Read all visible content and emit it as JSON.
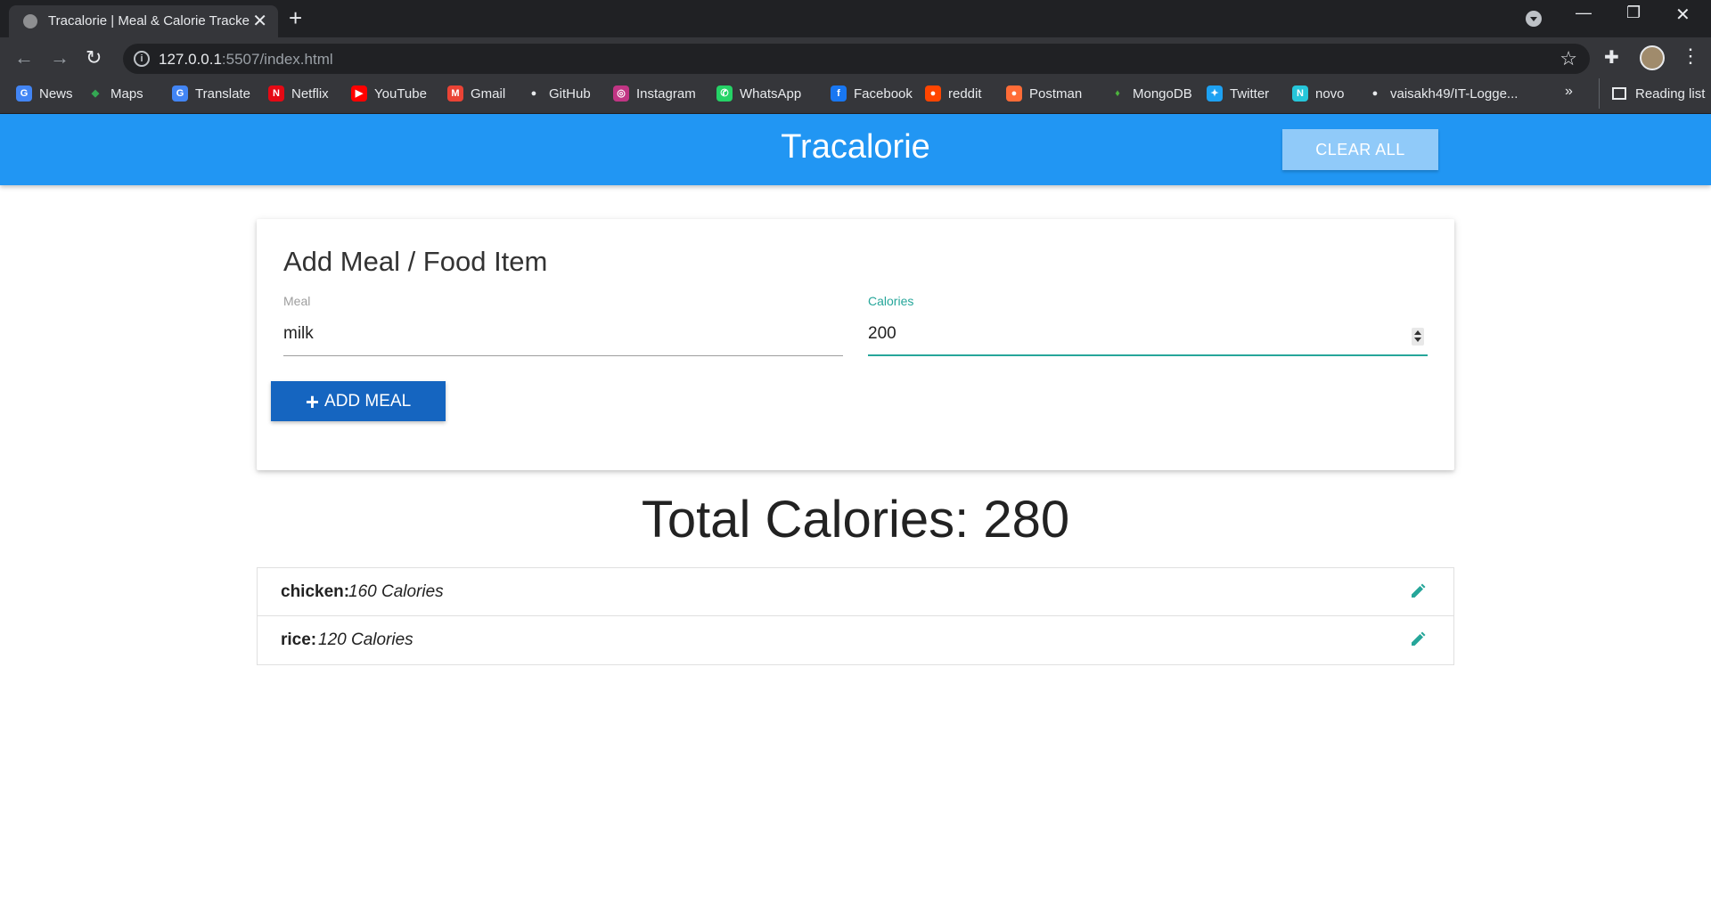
{
  "browser": {
    "tab_title": "Tracalorie | Meal & Calorie Tracke",
    "url_host": "127.0.0.1",
    "url_rest": ":5507/index.html",
    "bookmarks": [
      {
        "label": "News",
        "icon": "google-news-icon",
        "color": "#4285f4"
      },
      {
        "label": "Maps",
        "icon": "maps-pin-icon",
        "color": "#34a853"
      },
      {
        "label": "Translate",
        "icon": "translate-icon",
        "color": "#4285f4"
      },
      {
        "label": "Netflix",
        "icon": "netflix-icon",
        "color": "#e50914"
      },
      {
        "label": "YouTube",
        "icon": "youtube-icon",
        "color": "#ff0000"
      },
      {
        "label": "Gmail",
        "icon": "gmail-icon",
        "color": "#ea4335"
      },
      {
        "label": "GitHub",
        "icon": "github-icon",
        "color": "#e8eaed"
      },
      {
        "label": "Instagram",
        "icon": "instagram-icon",
        "color": "#c13584"
      },
      {
        "label": "WhatsApp",
        "icon": "whatsapp-icon",
        "color": "#25d366"
      },
      {
        "label": "Facebook",
        "icon": "facebook-icon",
        "color": "#1877f2"
      },
      {
        "label": "reddit",
        "icon": "reddit-icon",
        "color": "#ff4500"
      },
      {
        "label": "Postman",
        "icon": "postman-icon",
        "color": "#ff6c37"
      },
      {
        "label": "MongoDB",
        "icon": "mongodb-leaf-icon",
        "color": "#4db33d"
      },
      {
        "label": "Twitter",
        "icon": "twitter-icon",
        "color": "#1da1f2"
      },
      {
        "label": "novo",
        "icon": "novo-icon",
        "color": "#26c6da"
      },
      {
        "label": "vaisakh49/IT-Logge...",
        "icon": "github-icon",
        "color": "#e8eaed"
      }
    ],
    "overflow": "»",
    "reading_list": "Reading list"
  },
  "app": {
    "brand": "Tracalorie",
    "clear_all": "CLEAR ALL",
    "card_title": "Add Meal / Food Item",
    "meal_label": "Meal",
    "meal_value": "milk",
    "calories_label": "Calories",
    "calories_value": "200",
    "add_meal": "ADD MEAL",
    "total_text": "Total Calories: 280",
    "items": [
      {
        "name": "chicken:",
        "calories": "160 Calories"
      },
      {
        "name": "rice:",
        "calories": "120 Calories"
      }
    ],
    "colors": {
      "navbar": "#2196f3",
      "clear_button": "#90caf9",
      "add_button": "#1565c0",
      "accent": "#26a69a"
    }
  }
}
